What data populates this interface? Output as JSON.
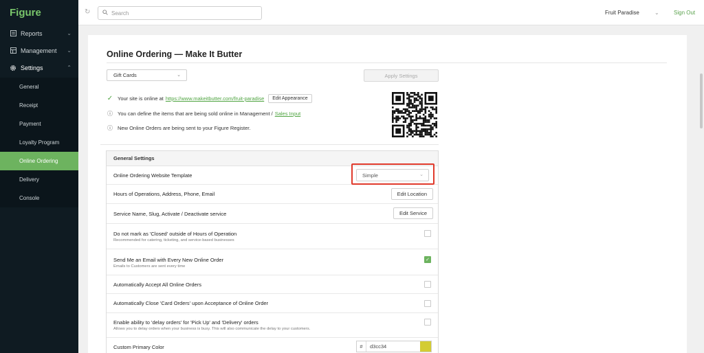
{
  "brand": "Figure",
  "sidebar": {
    "items": [
      {
        "label": "Reports",
        "icon": "report-icon"
      },
      {
        "label": "Management",
        "icon": "management-icon"
      },
      {
        "label": "Settings",
        "icon": "gear-icon"
      }
    ],
    "sub_items": [
      {
        "label": "General"
      },
      {
        "label": "Receipt"
      },
      {
        "label": "Payment"
      },
      {
        "label": "Loyalty Program"
      },
      {
        "label": "Online Ordering"
      },
      {
        "label": "Delivery"
      },
      {
        "label": "Console"
      }
    ]
  },
  "topbar": {
    "search_placeholder": "Search",
    "store": "Fruit Paradise",
    "signout": "Sign Out"
  },
  "page": {
    "title": "Online Ordering — Make It Butter",
    "dropdown_value": "Gift Cards",
    "apply_label": "Apply Settings"
  },
  "info": {
    "online_text": "Your site is online at",
    "site_url": "https://www.makeitbutter.com/fruit-paradise",
    "edit_appearance": "Edit Appearance",
    "items_text": "You can define the items that are being sold online in Management /",
    "sales_input": "Sales Input",
    "orders_text": "New Online Orders are being sent to your Figure Register."
  },
  "settings": {
    "header": "General Settings",
    "template_label": "Online Ordering Website Template",
    "template_value": "Simple",
    "hours_label": "Hours of Operations, Address, Phone, Email",
    "edit_location": "Edit Location",
    "service_label": "Service Name, Slug, Activate / Deactivate service",
    "edit_service": "Edit Service",
    "closed_label": "Do not mark as 'Closed' outside of Hours of Operation",
    "closed_desc": "Recommended for catering, ticketing, and service-based businesses",
    "closed_checked": false,
    "email_label": "Send Me an Email with Every New Online Order",
    "email_desc": "Emails to Customers are sent every time",
    "email_checked": true,
    "accept_label": "Automatically Accept All Online Orders",
    "accept_checked": false,
    "close_card_label": "Automatically Close 'Card Orders' upon Acceptance of Online Order",
    "close_card_checked": false,
    "delay_label": "Enable ability to 'delay orders' for 'Pick Up' and 'Delivery' orders",
    "delay_desc": "Allows you to delay orders when your business is busy. This will also communicate the delay to your customers.",
    "delay_checked": false,
    "color_label": "Custom Primary Color",
    "color_hash": "#",
    "color_value": "d3cc34",
    "color_swatch": "#d3cc34"
  },
  "colors": {
    "accent": "#6db35f",
    "sidebar_bg": "#0f1b22",
    "highlight": "#e0392b"
  }
}
